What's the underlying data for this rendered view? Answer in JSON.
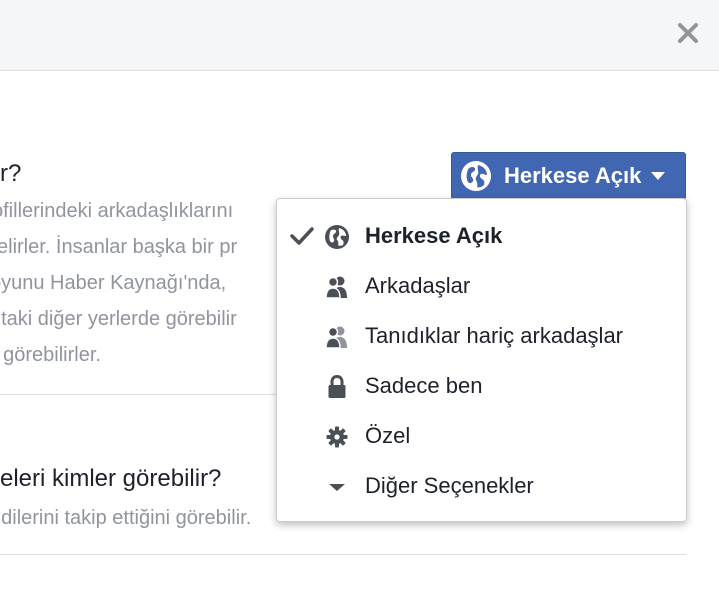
{
  "header": {
    "close_label": "×"
  },
  "section1": {
    "question": "r?",
    "description_lines": [
      "ofillerindeki arkadaşlıklarını",
      "elirler. İnsanlar başka bir pr",
      "oyunu Haber Kaynağı'nda,",
      "ntaki diğer yerlerde görebilir",
      "ı görebilirler."
    ]
  },
  "section2": {
    "question": "eleri kimler görebilir?",
    "description": "ndilerini takip ettiğini görebilir."
  },
  "audience_button": {
    "label": "Herkese Açık",
    "color": "#4267b2"
  },
  "dropdown": {
    "items": [
      {
        "label": "Herkese Açık",
        "icon": "globe-icon",
        "selected": true
      },
      {
        "label": "Arkadaşlar",
        "icon": "friends-icon",
        "selected": false
      },
      {
        "label": "Tanıdıklar hariç arkadaşlar",
        "icon": "friends-except-icon",
        "selected": false
      },
      {
        "label": "Sadece ben",
        "icon": "lock-icon",
        "selected": false
      },
      {
        "label": "Özel",
        "icon": "gear-icon",
        "selected": false
      },
      {
        "label": "Diğer Seçenekler",
        "icon": "triangle-down-icon",
        "selected": false
      }
    ]
  }
}
